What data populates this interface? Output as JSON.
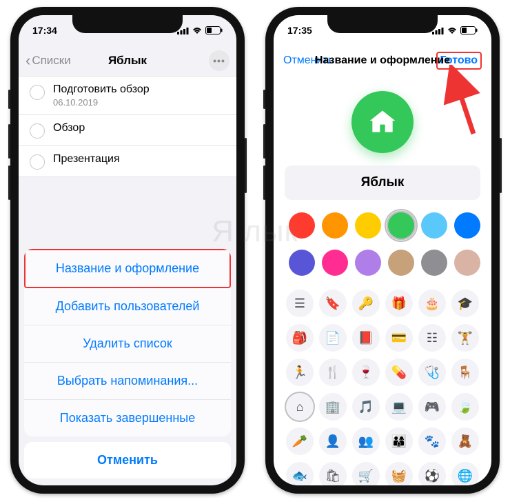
{
  "watermark": "Я  лык",
  "left": {
    "status": {
      "time": "17:34"
    },
    "nav": {
      "back": "Списки",
      "title": "Яблык"
    },
    "reminders": [
      {
        "title": "Подготовить обзор",
        "sub": "06.10.2019"
      },
      {
        "title": "Обзор",
        "sub": ""
      },
      {
        "title": "Презентация",
        "sub": ""
      }
    ],
    "sheet": {
      "items": [
        "Название и оформление",
        "Добавить пользователей",
        "Удалить список",
        "Выбрать напоминания...",
        "Показать завершенные"
      ],
      "cancel": "Отменить"
    }
  },
  "right": {
    "status": {
      "time": "17:35"
    },
    "modal": {
      "cancel": "Отменить",
      "title": "Название и оформление",
      "done": "Готово"
    },
    "name_field": "Яблык",
    "colors": [
      {
        "hex": "#ff3b30",
        "selected": false
      },
      {
        "hex": "#ff9500",
        "selected": false
      },
      {
        "hex": "#ffcc00",
        "selected": false
      },
      {
        "hex": "#34c759",
        "selected": true
      },
      {
        "hex": "#5ac8fa",
        "selected": false
      },
      {
        "hex": "#007aff",
        "selected": false
      },
      {
        "hex": "#5856d6",
        "selected": false
      },
      {
        "hex": "#ff2d92",
        "selected": false
      },
      {
        "hex": "#af7ee9",
        "selected": false
      },
      {
        "hex": "#c7a17a",
        "selected": false
      },
      {
        "hex": "#8e8e93",
        "selected": false
      },
      {
        "hex": "#d9b3a3",
        "selected": false
      }
    ],
    "icons": [
      {
        "name": "list-icon",
        "glyph": "☰",
        "selected": false
      },
      {
        "name": "bookmark-icon",
        "glyph": "🔖",
        "selected": false
      },
      {
        "name": "key-icon",
        "glyph": "🔑",
        "selected": false
      },
      {
        "name": "gift-icon",
        "glyph": "🎁",
        "selected": false
      },
      {
        "name": "cake-icon",
        "glyph": "🎂",
        "selected": false
      },
      {
        "name": "graduation-icon",
        "glyph": "🎓",
        "selected": false
      },
      {
        "name": "backpack-icon",
        "glyph": "🎒",
        "selected": false
      },
      {
        "name": "document-icon",
        "glyph": "📄",
        "selected": false
      },
      {
        "name": "book-icon",
        "glyph": "📕",
        "selected": false
      },
      {
        "name": "card-icon",
        "glyph": "💳",
        "selected": false
      },
      {
        "name": "pills-stack-icon",
        "glyph": "☷",
        "selected": false
      },
      {
        "name": "dumbbell-icon",
        "glyph": "🏋",
        "selected": false
      },
      {
        "name": "run-icon",
        "glyph": "🏃",
        "selected": false
      },
      {
        "name": "fork-icon",
        "glyph": "🍴",
        "selected": false
      },
      {
        "name": "wine-icon",
        "glyph": "🍷",
        "selected": false
      },
      {
        "name": "pill-icon",
        "glyph": "💊",
        "selected": false
      },
      {
        "name": "stethoscope-icon",
        "glyph": "🩺",
        "selected": false
      },
      {
        "name": "chair-icon",
        "glyph": "🪑",
        "selected": false
      },
      {
        "name": "house-icon",
        "glyph": "⌂",
        "selected": true
      },
      {
        "name": "building-icon",
        "glyph": "🏢",
        "selected": false
      },
      {
        "name": "music-icon",
        "glyph": "🎵",
        "selected": false
      },
      {
        "name": "laptop-icon",
        "glyph": "💻",
        "selected": false
      },
      {
        "name": "gamepad-icon",
        "glyph": "🎮",
        "selected": false
      },
      {
        "name": "leaf-icon",
        "glyph": "🍃",
        "selected": false
      },
      {
        "name": "carrot-icon",
        "glyph": "🥕",
        "selected": false
      },
      {
        "name": "person-icon",
        "glyph": "👤",
        "selected": false
      },
      {
        "name": "people-icon",
        "glyph": "👥",
        "selected": false
      },
      {
        "name": "family-icon",
        "glyph": "👨‍👩‍👦",
        "selected": false
      },
      {
        "name": "paw-icon",
        "glyph": "🐾",
        "selected": false
      },
      {
        "name": "teddy-icon",
        "glyph": "🧸",
        "selected": false
      },
      {
        "name": "fish-icon",
        "glyph": "🐟",
        "selected": false
      },
      {
        "name": "bag-icon",
        "glyph": "🛍",
        "selected": false
      },
      {
        "name": "cart-icon",
        "glyph": "🛒",
        "selected": false
      },
      {
        "name": "basket-icon",
        "glyph": "🧺",
        "selected": false
      },
      {
        "name": "ball-icon",
        "glyph": "⚽",
        "selected": false
      },
      {
        "name": "globe-icon",
        "glyph": "🌐",
        "selected": false
      }
    ]
  }
}
